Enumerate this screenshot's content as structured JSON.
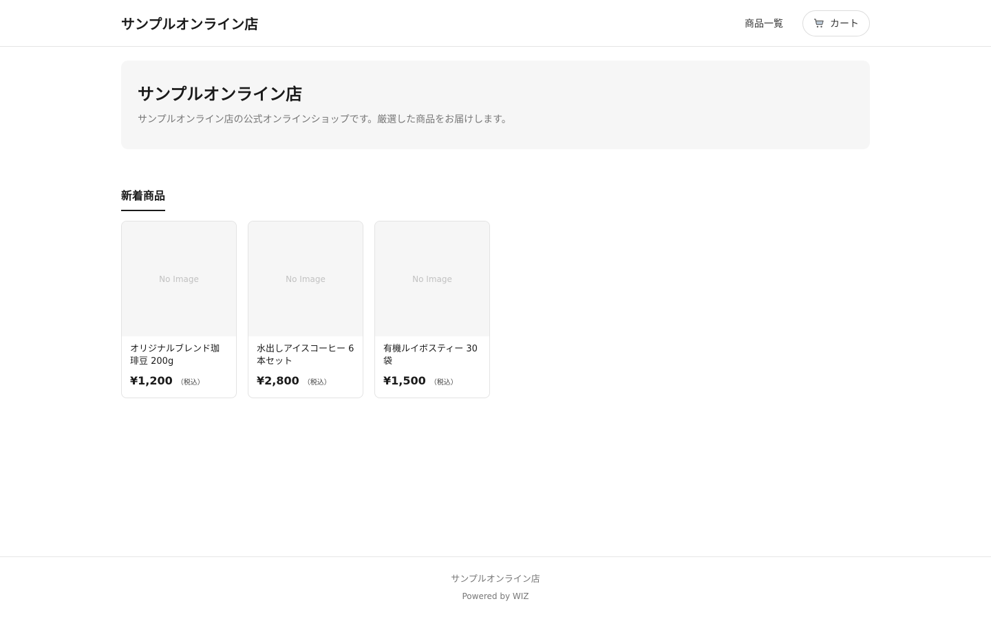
{
  "header": {
    "logo": "サンプルオンライン店",
    "nav_products": "商品一覧",
    "cart_label": "カート",
    "cart_icon": "cart-icon"
  },
  "hero": {
    "title": "サンプルオンライン店",
    "description": "サンプルオンライン店の公式オンラインショップです。厳選した商品をお届けします。"
  },
  "section": {
    "title": "新着商品"
  },
  "products": [
    {
      "image_placeholder": "No Image",
      "name": "オリジナルブレンド珈琲豆 200g",
      "price": "¥1,200",
      "tax": "（税込）"
    },
    {
      "image_placeholder": "No Image",
      "name": "水出しアイスコーヒー 6本セット",
      "price": "¥2,800",
      "tax": "（税込）"
    },
    {
      "image_placeholder": "No Image",
      "name": "有機ルイボスティー 30袋",
      "price": "¥1,500",
      "tax": "（税込）"
    }
  ],
  "footer": {
    "shop_name": "サンプルオンライン店",
    "powered": "Powered by WIZ"
  }
}
